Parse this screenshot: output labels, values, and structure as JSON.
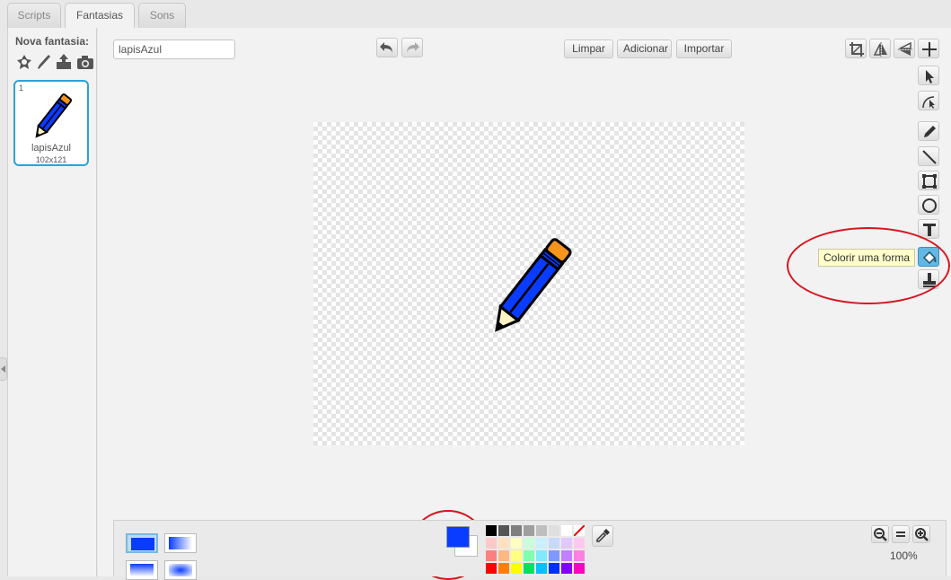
{
  "tabs": [
    {
      "label": "Scripts",
      "active": false
    },
    {
      "label": "Fantasias",
      "active": true
    },
    {
      "label": "Sons",
      "active": false
    }
  ],
  "costumes_pane": {
    "new_costume_label": "Nova fantasia:",
    "new_icons": [
      "sprite-library-icon",
      "paint-brush-icon",
      "upload-icon",
      "camera-icon"
    ],
    "costumes": [
      {
        "number": "1",
        "name": "lapisAzul",
        "size": "102x121",
        "selected": true
      }
    ]
  },
  "editor": {
    "costume_name_value": "lapisAzul",
    "buttons": {
      "clear": "Limpar",
      "add": "Adicionar",
      "import": "Importar"
    },
    "top_right_tools": [
      "crop-icon",
      "flip-horizontal-icon",
      "flip-vertical-icon",
      "set-center-icon"
    ],
    "tools": [
      {
        "name": "select-icon"
      },
      {
        "name": "reshape-icon"
      },
      {
        "name": "pencil-icon"
      },
      {
        "name": "line-icon"
      },
      {
        "name": "rectangle-icon"
      },
      {
        "name": "ellipse-icon"
      },
      {
        "name": "text-icon"
      },
      {
        "name": "fill-bucket-icon",
        "active": true
      },
      {
        "name": "stamp-icon"
      }
    ],
    "tooltip": "Colorir uma forma"
  },
  "bottom": {
    "primary_color": "#0a3cff",
    "secondary_color": "#ffffff",
    "zoom_level": "100%",
    "palette_rows": [
      [
        "#000000",
        "#555555",
        "#7f7f7f",
        "#9f9f9f",
        "#bfbfbf",
        "#dfdfdf",
        "#ffffff",
        "none"
      ],
      [
        "#ffc8c8",
        "#ffe0c0",
        "#ffffc0",
        "#c8ffd8",
        "#c8f0ff",
        "#c8d8ff",
        "#e0c8ff",
        "#ffc8f0"
      ],
      [
        "#ff8080",
        "#ffb880",
        "#ffff80",
        "#80ffb0",
        "#80e8ff",
        "#8098ff",
        "#c080ff",
        "#ff80e0"
      ],
      [
        "#ff0000",
        "#ff8000",
        "#ffff00",
        "#00e060",
        "#00c0ff",
        "#0030ff",
        "#8000ff",
        "#ff00c0"
      ]
    ]
  },
  "colors": {
    "accent_selection": "#29a3d9",
    "annotation_red": "#d9131f",
    "pencil_blue": "#0a3cff",
    "pencil_eraser": "#f7941d"
  }
}
